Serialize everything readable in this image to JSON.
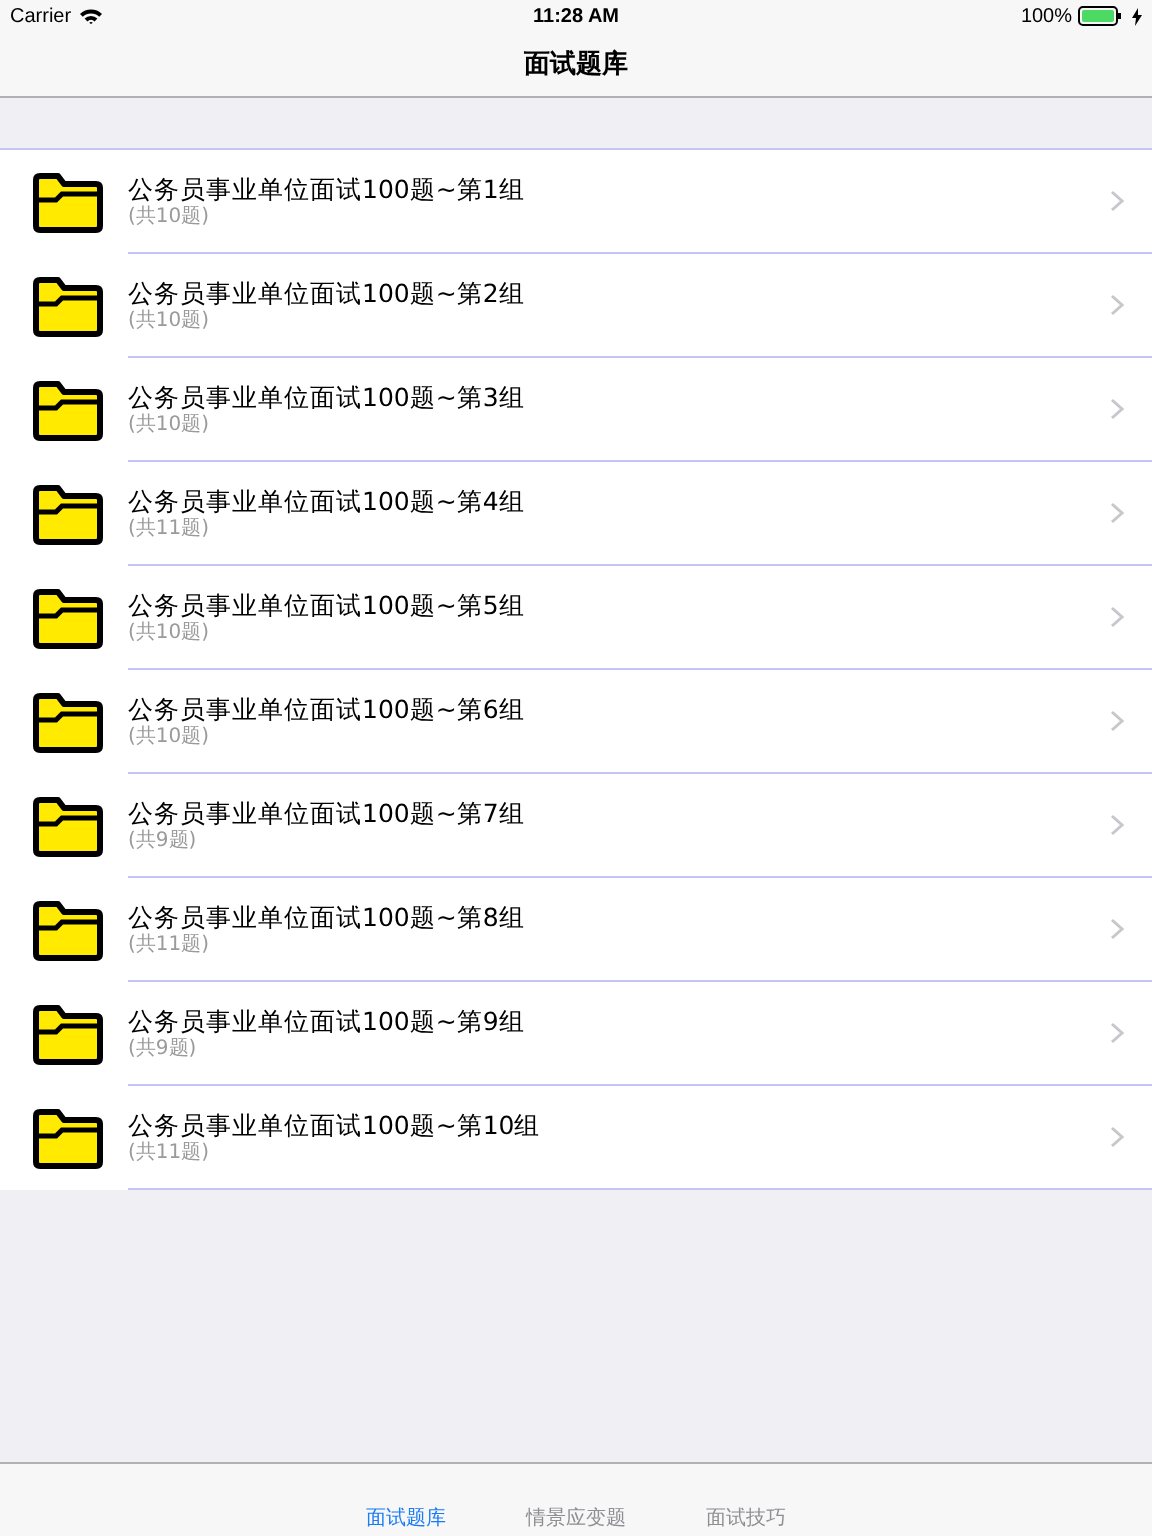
{
  "status_bar": {
    "carrier": "Carrier",
    "time": "11:28 AM",
    "battery": "100%"
  },
  "nav_bar": {
    "title": "面试题库"
  },
  "rows": [
    {
      "title": "公务员事业单位面试100题~第1组",
      "subtitle": "(共10题)"
    },
    {
      "title": "公务员事业单位面试100题~第2组",
      "subtitle": "(共10题)"
    },
    {
      "title": "公务员事业单位面试100题~第3组",
      "subtitle": "(共10题)"
    },
    {
      "title": "公务员事业单位面试100题~第4组",
      "subtitle": "(共11题)"
    },
    {
      "title": "公务员事业单位面试100题~第5组",
      "subtitle": "(共10题)"
    },
    {
      "title": "公务员事业单位面试100题~第6组",
      "subtitle": "(共10题)"
    },
    {
      "title": "公务员事业单位面试100题~第7组",
      "subtitle": "(共9题)"
    },
    {
      "title": "公务员事业单位面试100题~第8组",
      "subtitle": "(共11题)"
    },
    {
      "title": "公务员事业单位面试100题~第9组",
      "subtitle": "(共9题)"
    },
    {
      "title": "公务员事业单位面试100题~第10组",
      "subtitle": "(共11题)"
    }
  ],
  "tab_bar": [
    {
      "label": "面试题库",
      "selected": true
    },
    {
      "label": "情景应变题",
      "selected": false
    },
    {
      "label": "面试技巧",
      "selected": false
    }
  ]
}
